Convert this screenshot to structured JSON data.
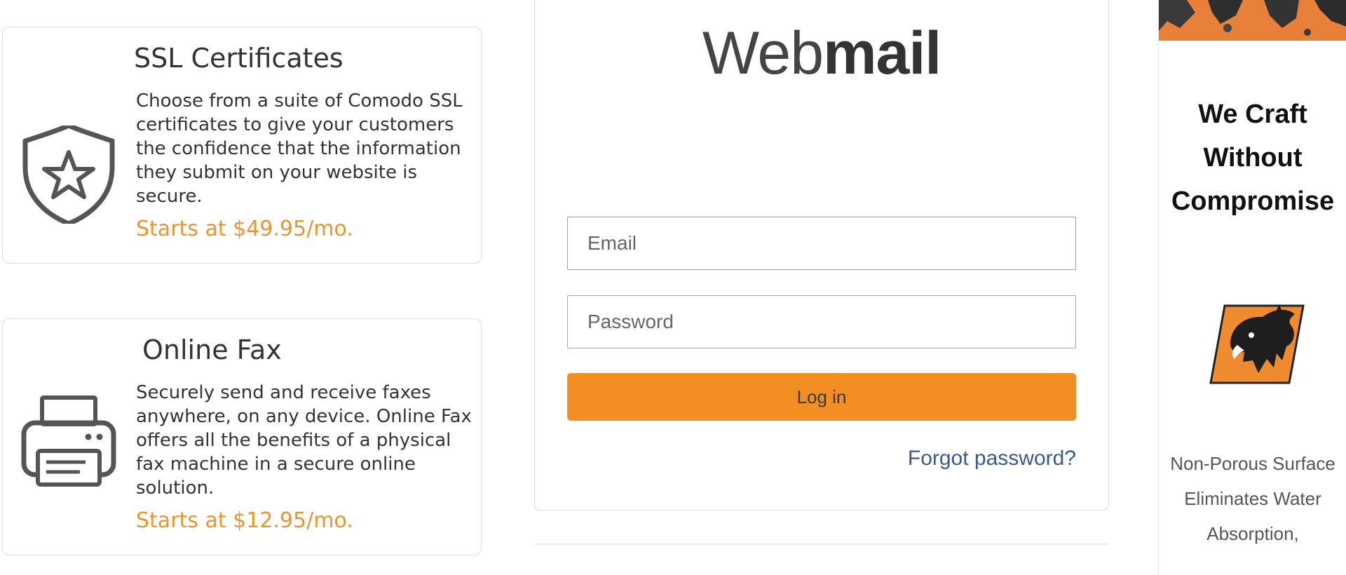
{
  "cards": [
    {
      "title": "SSL Certificates",
      "icon": "shield-star-icon",
      "description": "Choose from a suite of Comodo SSL certificates to give your customers the confidence that the information they submit on your website is secure.",
      "price": "Starts at $49.95/mo."
    },
    {
      "title": "Online Fax",
      "icon": "printer-icon",
      "description": "Securely send and receive faxes anywhere, on any device. Online Fax offers all the benefits of a physical fax machine in a secure online solution.",
      "price": "Starts at $12.95/mo."
    }
  ],
  "login": {
    "title_light": "Web",
    "title_bold": "mail",
    "email_placeholder": "Email",
    "password_placeholder": "Password",
    "button_label": "Log in",
    "forgot_label": "Forgot password?"
  },
  "ad": {
    "headline": "We Craft Without Compromise",
    "body": "Non-Porous Surface Eliminates Water Absorption,",
    "logo_icon": "boar-icon"
  },
  "colors": {
    "accent": "#f28e22",
    "price": "#e8952f",
    "link": "#3b5a86",
    "ad_banner": "#e8803a"
  }
}
